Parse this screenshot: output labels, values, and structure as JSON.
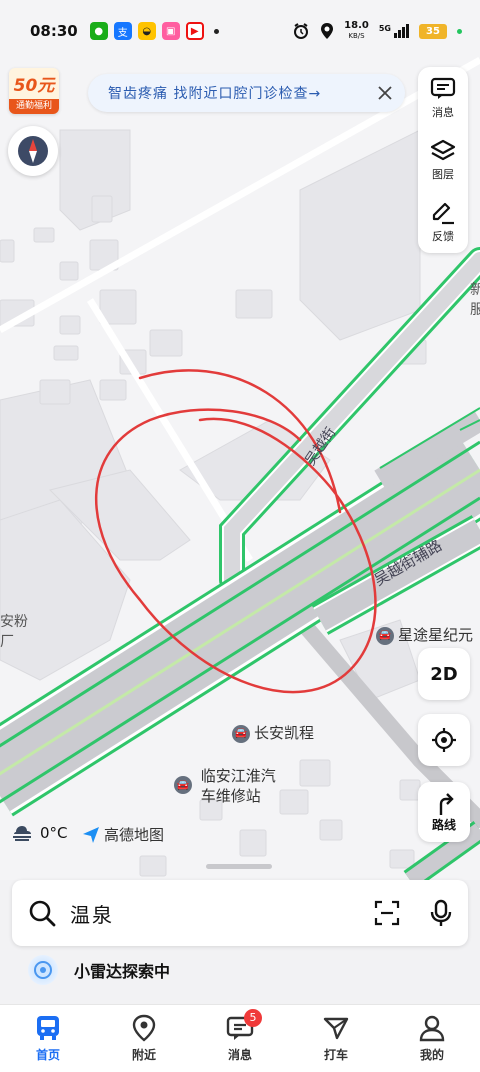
{
  "status": {
    "time": "08:30",
    "speed_value": "18.0",
    "speed_unit": "KB/S",
    "network": "5G",
    "battery": "35"
  },
  "badge": {
    "amount": "50元",
    "subtitle": "通勤福利"
  },
  "banner": {
    "text": "智齿疼痛 找附近口腔门诊检查→"
  },
  "toolbar": {
    "messages": "消息",
    "layers": "图层",
    "feedback": "反馈"
  },
  "map": {
    "pois": [
      {
        "name": "星途星纪元"
      },
      {
        "name": "长安凯程"
      },
      {
        "name": "临安江淮汽"
      },
      {
        "name": "车维修站"
      }
    ],
    "roads": [
      {
        "name": "吴越街辅路"
      },
      {
        "name": "吴越街"
      }
    ],
    "edge_labels": {
      "left_1": "安粉",
      "left_2": "厂",
      "right_1": "新",
      "right_2": "服"
    }
  },
  "map_controls": {
    "view_mode": "2D",
    "route": "路线"
  },
  "weather": {
    "temp": "0°C"
  },
  "logo": {
    "text": "高德地图"
  },
  "search": {
    "query": "温泉"
  },
  "radar": {
    "text": "小雷达探索中"
  },
  "nav": {
    "items": [
      {
        "label": "首页",
        "icon": "bus-icon"
      },
      {
        "label": "附近",
        "icon": "location-pin-icon"
      },
      {
        "label": "消息",
        "icon": "message-icon",
        "badge": "5"
      },
      {
        "label": "打车",
        "icon": "taxi-icon"
      },
      {
        "label": "我的",
        "icon": "user-icon"
      }
    ]
  },
  "colors": {
    "accent": "#1b6ef3",
    "road_edge": "#2fc56a",
    "annotation": "#e23b3b"
  }
}
